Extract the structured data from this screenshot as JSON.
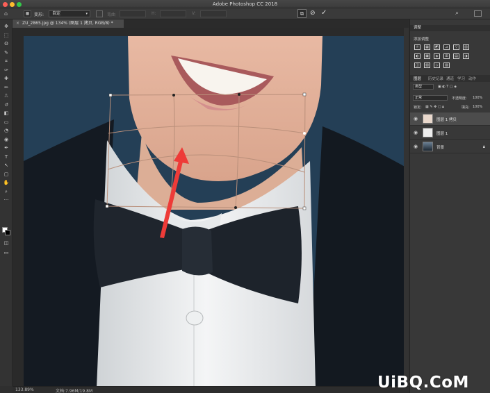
{
  "app": {
    "title": "Adobe Photoshop CC 2018",
    "colors": {
      "accent": "#fc5f57",
      "panel": "#383838",
      "toolbar": "#3a3a3a",
      "canvas": "#2a2a2a",
      "arrow": "#ee3b38"
    }
  },
  "options_bar": {
    "home_icon": "home-icon",
    "warp_label": "变形:",
    "warp_value": "自定",
    "grid_icon": "warp-grid-icon",
    "dim_labels": [
      "弯曲",
      "H:",
      "V:"
    ],
    "warp_mode_icon": "warp-mode-icon",
    "cancel_icon": "cancel-icon",
    "commit_icon": "commit-icon",
    "search_icon": "search-icon",
    "workspace_icon": "workspace-icon"
  },
  "document": {
    "tab_title": "ZU_2865.jpg @ 134% (图层 1 拷贝, RGB/8) *",
    "zoom": "133.89%",
    "doc_info": "文档:7.96M/19.8M"
  },
  "tools": {
    "items": [
      "move-icon",
      "marquee-icon",
      "lasso-icon",
      "quick-select-icon",
      "crop-icon",
      "eyedropper-icon",
      "healing-icon",
      "brush-icon",
      "stamp-icon",
      "history-brush-icon",
      "eraser-icon",
      "gradient-icon",
      "blur-icon",
      "dodge-icon",
      "pen-icon",
      "type-icon",
      "path-select-icon",
      "shape-icon",
      "hand-icon",
      "zoom-icon",
      "more-icon"
    ],
    "glyphs": [
      "✥",
      "⬚",
      "ʘ",
      "✎",
      "⌗",
      "✑",
      "✚",
      "✏",
      "⎍",
      "↺",
      "◧",
      "▭",
      "◔",
      "◉",
      "✒",
      "T",
      "↖",
      "▢",
      "✋",
      "⌕",
      "···"
    ]
  },
  "panels": {
    "adjust_head": "调整",
    "adjust_title": "添加调整",
    "adjust_icons": [
      "☼",
      "▦",
      "◩",
      "⊿",
      "▽",
      "▥",
      "◐",
      "▣",
      "◈",
      "⊞",
      "▤",
      "◑",
      "◫",
      "▧",
      "◇",
      "▨"
    ],
    "layer_tabs": [
      "图层",
      "历史记录",
      "通道",
      "学习",
      "动作"
    ],
    "filter_label": "类型",
    "blend_mode": "正常",
    "opacity_label": "不透明度:",
    "opacity_value": "100%",
    "lock_label": "锁定:",
    "fill_label": "填充:",
    "fill_value": "100%",
    "layers": [
      {
        "name": "图层 1 拷贝",
        "visible": true,
        "active": true
      },
      {
        "name": "图层 1",
        "visible": true,
        "active": false
      },
      {
        "name": "背景",
        "visible": true,
        "active": false,
        "locked": true
      }
    ]
  },
  "watermark": "UiBQ.CoM"
}
